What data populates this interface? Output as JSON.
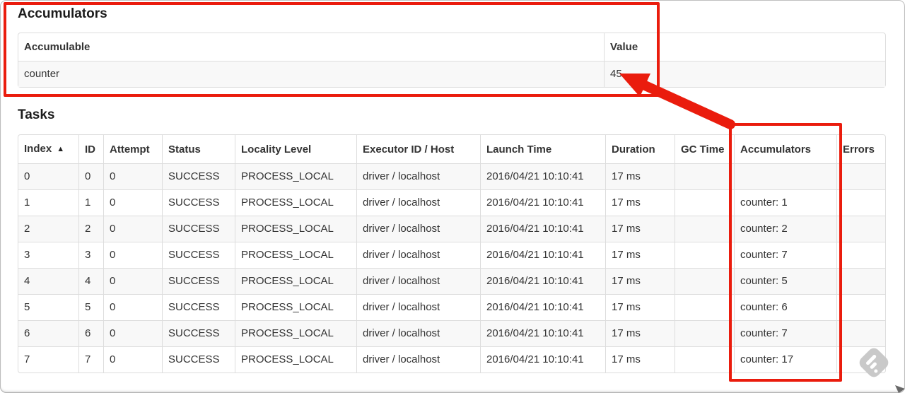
{
  "annotation_color": "#ea1c0d",
  "accumulators_section": {
    "heading": "Accumulators",
    "table": {
      "headers": [
        "Accumulable",
        "Value"
      ],
      "rows": [
        [
          "counter",
          "45"
        ]
      ]
    }
  },
  "tasks_section": {
    "heading": "Tasks",
    "table": {
      "headers": [
        "Index",
        "ID",
        "Attempt",
        "Status",
        "Locality Level",
        "Executor ID / Host",
        "Launch Time",
        "Duration",
        "GC Time",
        "Accumulators",
        "Errors"
      ],
      "sorted_column": 0,
      "sort_icon": "▲",
      "rows": [
        [
          "0",
          "0",
          "0",
          "SUCCESS",
          "PROCESS_LOCAL",
          "driver / localhost",
          "2016/04/21 10:10:41",
          "17 ms",
          "",
          "",
          ""
        ],
        [
          "1",
          "1",
          "0",
          "SUCCESS",
          "PROCESS_LOCAL",
          "driver / localhost",
          "2016/04/21 10:10:41",
          "17 ms",
          "",
          "counter: 1",
          ""
        ],
        [
          "2",
          "2",
          "0",
          "SUCCESS",
          "PROCESS_LOCAL",
          "driver / localhost",
          "2016/04/21 10:10:41",
          "17 ms",
          "",
          "counter: 2",
          ""
        ],
        [
          "3",
          "3",
          "0",
          "SUCCESS",
          "PROCESS_LOCAL",
          "driver / localhost",
          "2016/04/21 10:10:41",
          "17 ms",
          "",
          "counter: 7",
          ""
        ],
        [
          "4",
          "4",
          "0",
          "SUCCESS",
          "PROCESS_LOCAL",
          "driver / localhost",
          "2016/04/21 10:10:41",
          "17 ms",
          "",
          "counter: 5",
          ""
        ],
        [
          "5",
          "5",
          "0",
          "SUCCESS",
          "PROCESS_LOCAL",
          "driver / localhost",
          "2016/04/21 10:10:41",
          "17 ms",
          "",
          "counter: 6",
          ""
        ],
        [
          "6",
          "6",
          "0",
          "SUCCESS",
          "PROCESS_LOCAL",
          "driver / localhost",
          "2016/04/21 10:10:41",
          "17 ms",
          "",
          "counter: 7",
          ""
        ],
        [
          "7",
          "7",
          "0",
          "SUCCESS",
          "PROCESS_LOCAL",
          "driver / localhost",
          "2016/04/21 10:10:41",
          "17 ms",
          "",
          "counter: 17",
          ""
        ]
      ]
    }
  }
}
